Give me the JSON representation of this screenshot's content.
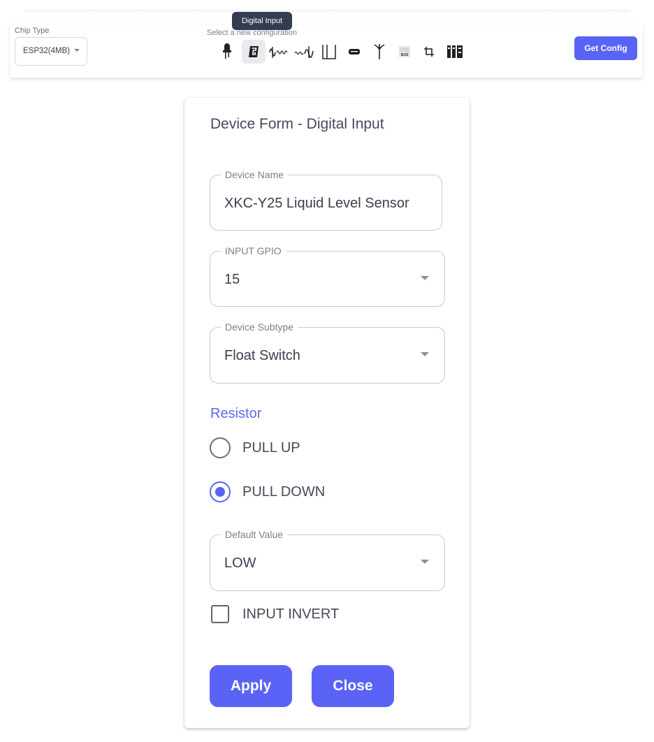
{
  "toolbar": {
    "chip_type_label": "Chip Type",
    "chip_type_value": "ESP32(4MB)",
    "config_label": "Select a new configuration",
    "tooltip": "Digital Input",
    "get_config_label": "Get Config",
    "accent_color": "#5864f5",
    "icons": [
      {
        "name": "led-icon",
        "active": false
      },
      {
        "name": "digital-input-icon",
        "active": true
      },
      {
        "name": "analog-wave-icon",
        "active": false
      },
      {
        "name": "pwm-wave-icon",
        "active": false
      },
      {
        "name": "relay-output-icon",
        "active": false
      },
      {
        "name": "display-icon",
        "active": false
      },
      {
        "name": "antenna-icon",
        "active": false
      },
      {
        "name": "bus-icon",
        "active": false
      },
      {
        "name": "i2c-connection-icon",
        "active": false
      },
      {
        "name": "sensor-module-icon",
        "active": false
      }
    ]
  },
  "form": {
    "title": "Device Form - Digital Input",
    "device_name": {
      "label": "Device Name",
      "value": "XKC-Y25 Liquid Level Sensor"
    },
    "input_gpio": {
      "label": "INPUT GPIO",
      "value": "15"
    },
    "device_subtype": {
      "label": "Device Subtype",
      "value": "Float Switch"
    },
    "resistor": {
      "label": "Resistor",
      "options": [
        {
          "label": "PULL UP",
          "selected": false
        },
        {
          "label": "PULL DOWN",
          "selected": true
        }
      ]
    },
    "default_value": {
      "label": "Default Value",
      "value": "LOW"
    },
    "input_invert": {
      "label": "INPUT INVERT",
      "checked": false
    },
    "apply_label": "Apply",
    "close_label": "Close"
  }
}
